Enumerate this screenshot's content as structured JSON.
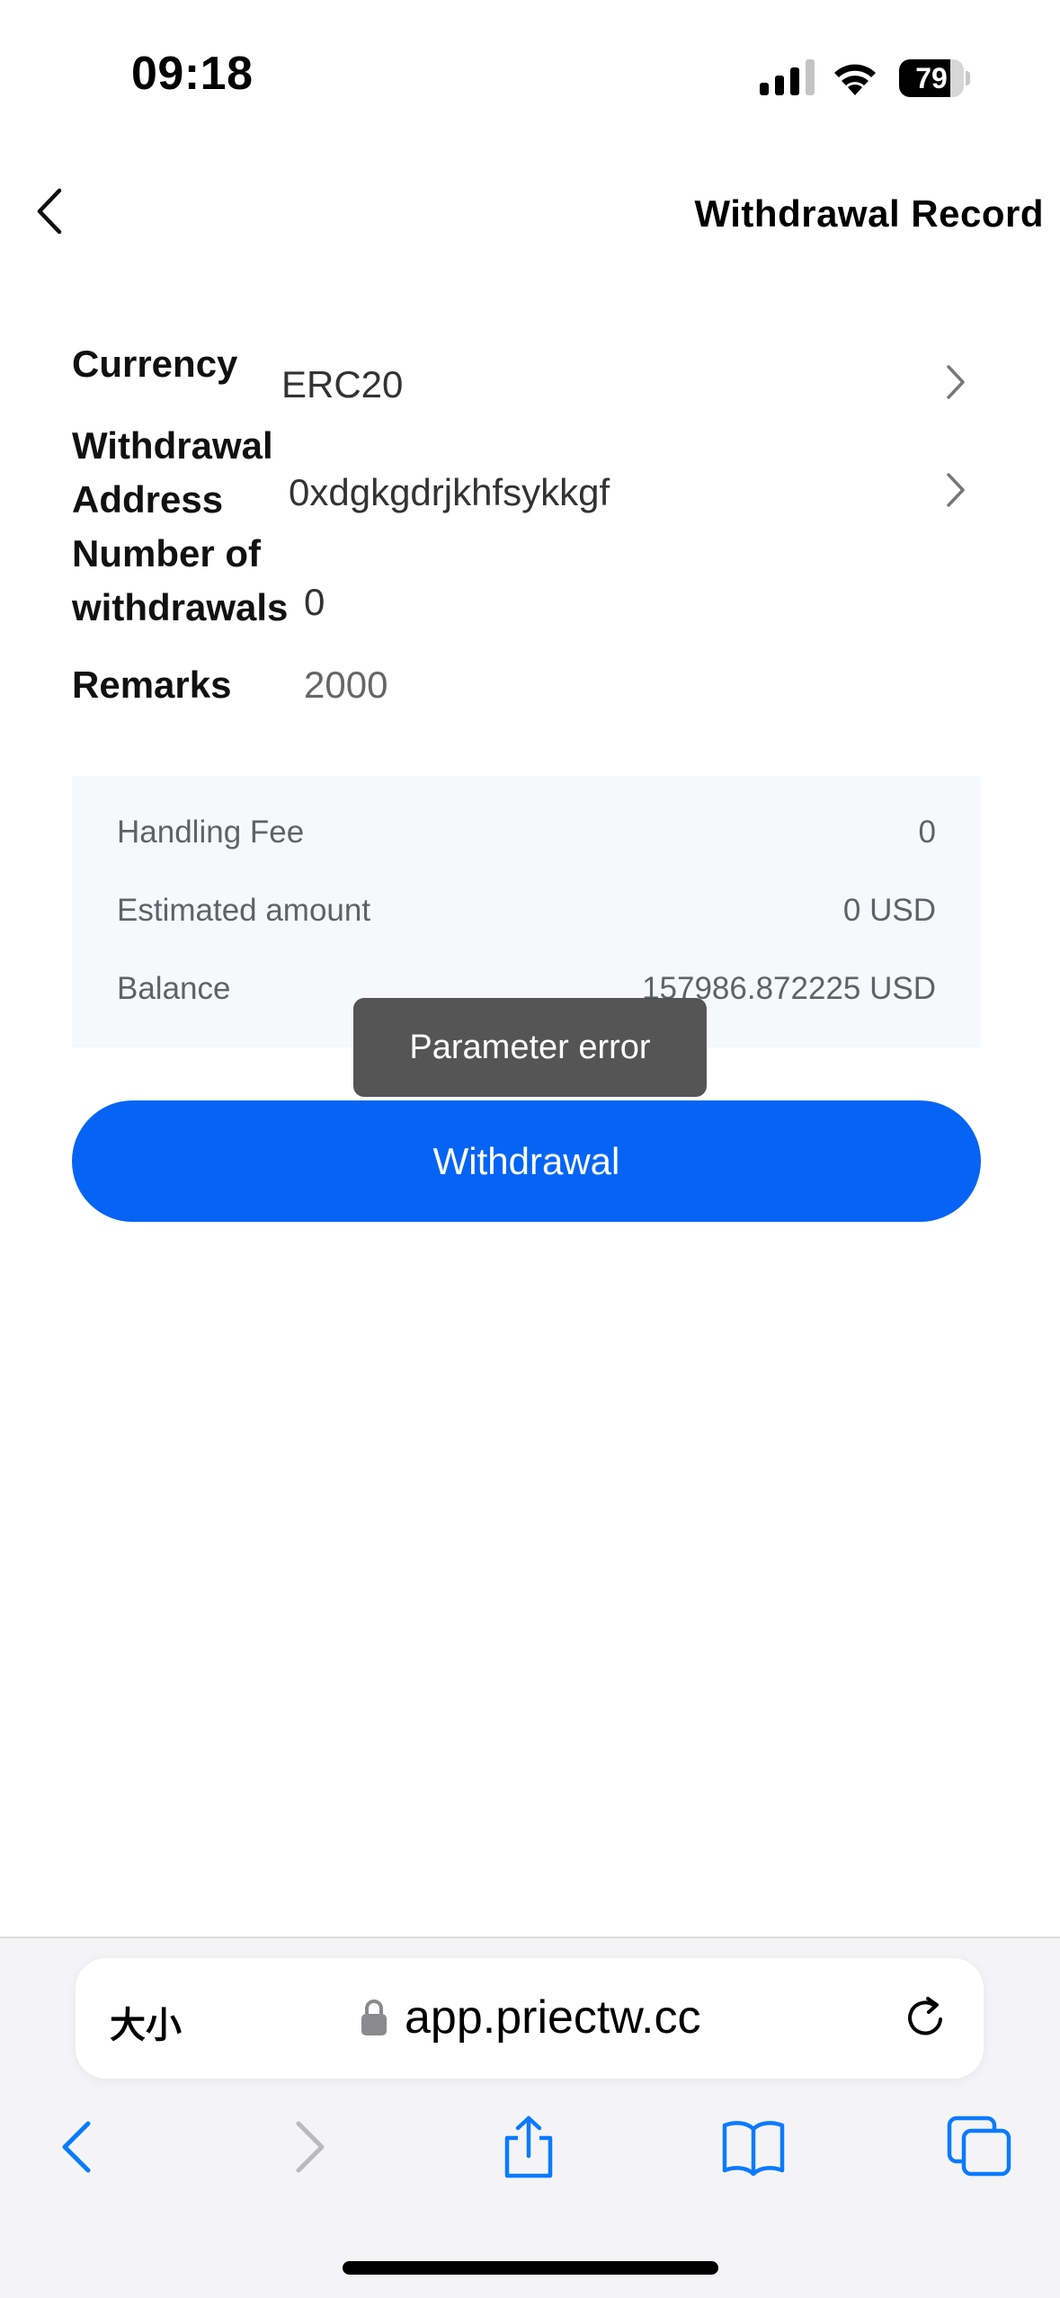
{
  "status_bar": {
    "time": "09:18",
    "battery": "79",
    "battery_level": 0.79
  },
  "header": {
    "title": "Withdrawal Record"
  },
  "form": {
    "currency_label": "Currency",
    "currency_value": "ERC20",
    "address_label_line1": "Withdrawal",
    "address_label_line2": "Address",
    "address_value": "0xdgkgdrjkhfsykkgf",
    "number_label_line1": "Number of",
    "number_label_line2": "withdrawals",
    "number_value": "0",
    "remarks_label": "Remarks",
    "remarks_value": "2000"
  },
  "summary": {
    "fee_label": "Handling Fee",
    "fee_value": "0",
    "estimated_label": "Estimated amount",
    "estimated_value": "0 USD",
    "balance_label": "Balance",
    "balance_value": "157986.872225 USD"
  },
  "toast": {
    "message": "Parameter error"
  },
  "withdraw_button": {
    "label": "Withdrawal"
  },
  "browser": {
    "text_size_label": "大小",
    "url": "app.priectw.cc"
  },
  "icons": {
    "back": "back-chevron-icon",
    "chevron": "chevron-right-icon",
    "lock": "lock-icon",
    "reload": "reload-icon",
    "share": "share-icon",
    "bookmarks": "book-icon",
    "tabs": "tabs-icon"
  },
  "colors": {
    "accent": "#0564f5",
    "panel_bg": "#f6f8fc",
    "toast_bg": "#464646"
  }
}
